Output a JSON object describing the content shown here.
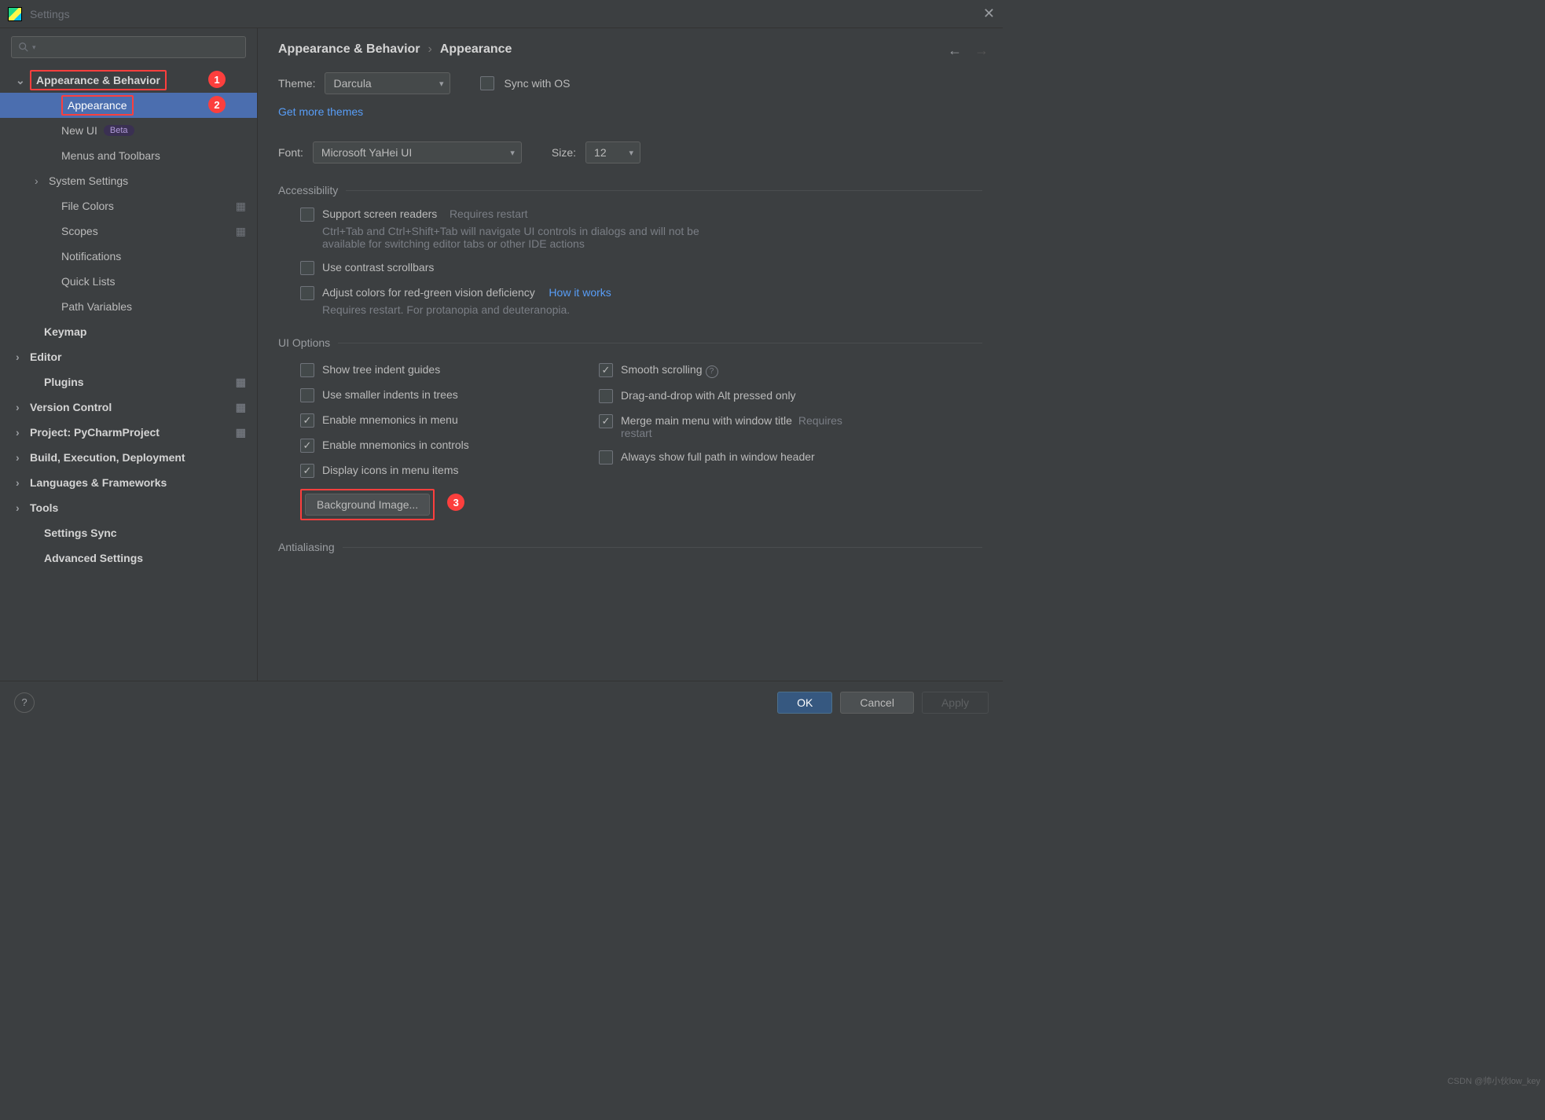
{
  "window": {
    "title": "Settings"
  },
  "breadcrumb": {
    "group": "Appearance & Behavior",
    "page": "Appearance",
    "sep": "›"
  },
  "sidebar": {
    "items": [
      {
        "label": "Appearance & Behavior",
        "type": "group",
        "expanded": true,
        "redbox": true,
        "annot": "1"
      },
      {
        "label": "Appearance",
        "type": "sub",
        "selected": true,
        "redbox": true,
        "annot": "2"
      },
      {
        "label": "New UI",
        "type": "sub",
        "badge": "Beta"
      },
      {
        "label": "Menus and Toolbars",
        "type": "sub"
      },
      {
        "label": "System Settings",
        "type": "subgroup"
      },
      {
        "label": "File Colors",
        "type": "sub",
        "iconR": true
      },
      {
        "label": "Scopes",
        "type": "sub",
        "iconR": true
      },
      {
        "label": "Notifications",
        "type": "sub"
      },
      {
        "label": "Quick Lists",
        "type": "sub"
      },
      {
        "label": "Path Variables",
        "type": "sub"
      },
      {
        "label": "Keymap",
        "type": "top"
      },
      {
        "label": "Editor",
        "type": "group"
      },
      {
        "label": "Plugins",
        "type": "top",
        "iconR": true
      },
      {
        "label": "Version Control",
        "type": "group",
        "iconR": true
      },
      {
        "label": "Project: PyCharmProject",
        "type": "group",
        "iconR": true
      },
      {
        "label": "Build, Execution, Deployment",
        "type": "group"
      },
      {
        "label": "Languages & Frameworks",
        "type": "group"
      },
      {
        "label": "Tools",
        "type": "group"
      },
      {
        "label": "Settings Sync",
        "type": "top"
      },
      {
        "label": "Advanced Settings",
        "type": "top"
      }
    ]
  },
  "theme": {
    "label": "Theme:",
    "value": "Darcula",
    "sync": "Sync with OS",
    "more": "Get more themes"
  },
  "font": {
    "label": "Font:",
    "value": "Microsoft YaHei UI",
    "sizeLabel": "Size:",
    "sizeValue": "12"
  },
  "sections": {
    "accessibility": {
      "title": "Accessibility",
      "screen": {
        "label": "Support screen readers",
        "hint": "Requires restart",
        "desc": "Ctrl+Tab and Ctrl+Shift+Tab will navigate UI controls in dialogs and will not be available for switching editor tabs or other IDE actions"
      },
      "contrast": {
        "label": "Use contrast scrollbars"
      },
      "colorblind": {
        "label": "Adjust colors for red-green vision deficiency",
        "link": "How it works",
        "desc": "Requires restart. For protanopia and deuteranopia."
      }
    },
    "uioptions": {
      "title": "UI Options",
      "left": [
        {
          "label": "Show tree indent guides",
          "checked": false
        },
        {
          "label": "Use smaller indents in trees",
          "checked": false
        },
        {
          "label": "Enable mnemonics in menu",
          "checked": true
        },
        {
          "label": "Enable mnemonics in controls",
          "checked": true
        },
        {
          "label": "Display icons in menu items",
          "checked": true
        }
      ],
      "right": [
        {
          "label": "Smooth scrolling",
          "checked": true,
          "q": true
        },
        {
          "label": "Drag-and-drop with Alt pressed only",
          "checked": false
        },
        {
          "label": "Merge main menu with window title",
          "checked": true,
          "hint": "Requires restart"
        },
        {
          "label": "Always show full path in window header",
          "checked": false
        }
      ],
      "bgButton": "Background Image...",
      "bgAnnot": "3"
    },
    "antialiasing": {
      "title": "Antialiasing"
    }
  },
  "footer": {
    "ok": "OK",
    "cancel": "Cancel",
    "apply": "Apply"
  },
  "watermark": "CSDN @帅小伙low_key"
}
